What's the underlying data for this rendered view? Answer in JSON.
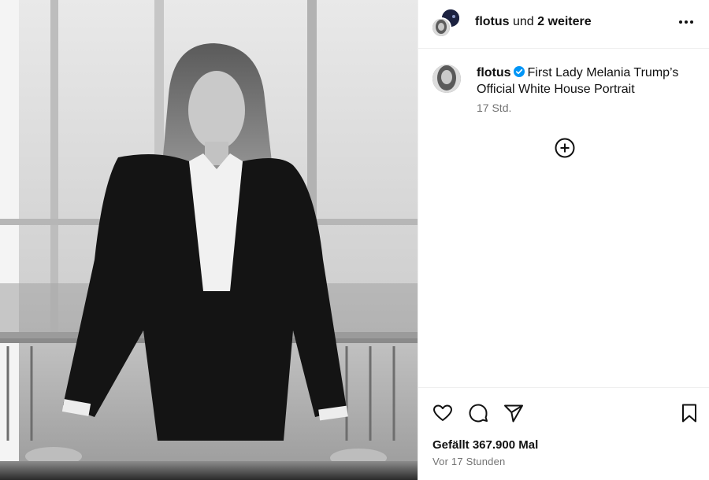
{
  "header": {
    "primary_user": "flotus",
    "joiner": "und",
    "others": "2 weitere",
    "more_icon": "more-horizontal-icon"
  },
  "caption": {
    "username": "flotus",
    "verified_color": "#0095f6",
    "text": "First Lady Melania Trump’s Official White House Portrait",
    "time": "17 Std."
  },
  "add_icon": "plus-circle-icon",
  "actions": {
    "icons": [
      "heart-icon",
      "comment-icon",
      "share-icon",
      "bookmark-icon"
    ],
    "likes": "Gefällt 367.900 Mal",
    "posted": "Vor 17 Stunden"
  },
  "colors": {
    "text": "#111111",
    "muted": "#737373",
    "divider": "#efefef"
  }
}
